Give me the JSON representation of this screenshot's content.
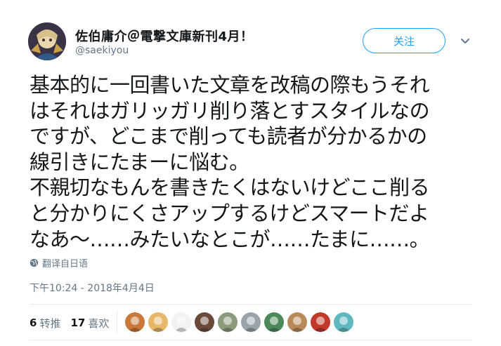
{
  "author": {
    "name": "佐伯庸介＠電撃文庫新刊4月！",
    "handle": "@saekiyou"
  },
  "follow_button": {
    "label": "关注"
  },
  "tweet": {
    "lines": [
      "基本的に一回書いた文章を改稿の際もうそれ",
      "はそれはガリッガリ削り落とすスタイルなの",
      "ですが、どこまで削っても読者が分かるかの",
      "線引きにたまーに悩む。",
      "不親切なもんを書きたくはないけどここ削る",
      "と分かりにくさアップするけどスマートだよ",
      "なあ～……みたいなとこが……たまに……。"
    ]
  },
  "translate_label": "翻译自日语",
  "timestamp": "下午10:24 - 2018年4月4日",
  "stats": {
    "retweets": {
      "count": "6",
      "label": "转推"
    },
    "likes": {
      "count": "17",
      "label": "喜欢"
    }
  },
  "icons": {
    "caret": "chevron-down-icon",
    "translate": "globe-icon"
  },
  "colors": {
    "accent": "#1da1f2",
    "secondary_text": "#657786",
    "primary_text": "#14171a",
    "divider": "#e6ecf0"
  },
  "liker_avatars": [
    {
      "name": "liker-1",
      "bg": "#c97a3a"
    },
    {
      "name": "liker-2",
      "bg": "#e8b76a"
    },
    {
      "name": "liker-3",
      "bg": "#f2f2f2"
    },
    {
      "name": "liker-4",
      "bg": "#6b4a3a"
    },
    {
      "name": "liker-5",
      "bg": "#8a9a7a"
    },
    {
      "name": "liker-6",
      "bg": "#9aa4ad"
    },
    {
      "name": "liker-7",
      "bg": "#4d8a5a"
    },
    {
      "name": "liker-8",
      "bg": "#b88a5a"
    },
    {
      "name": "liker-9",
      "bg": "#c0392b"
    },
    {
      "name": "liker-10",
      "bg": "#5fb8c0"
    }
  ]
}
